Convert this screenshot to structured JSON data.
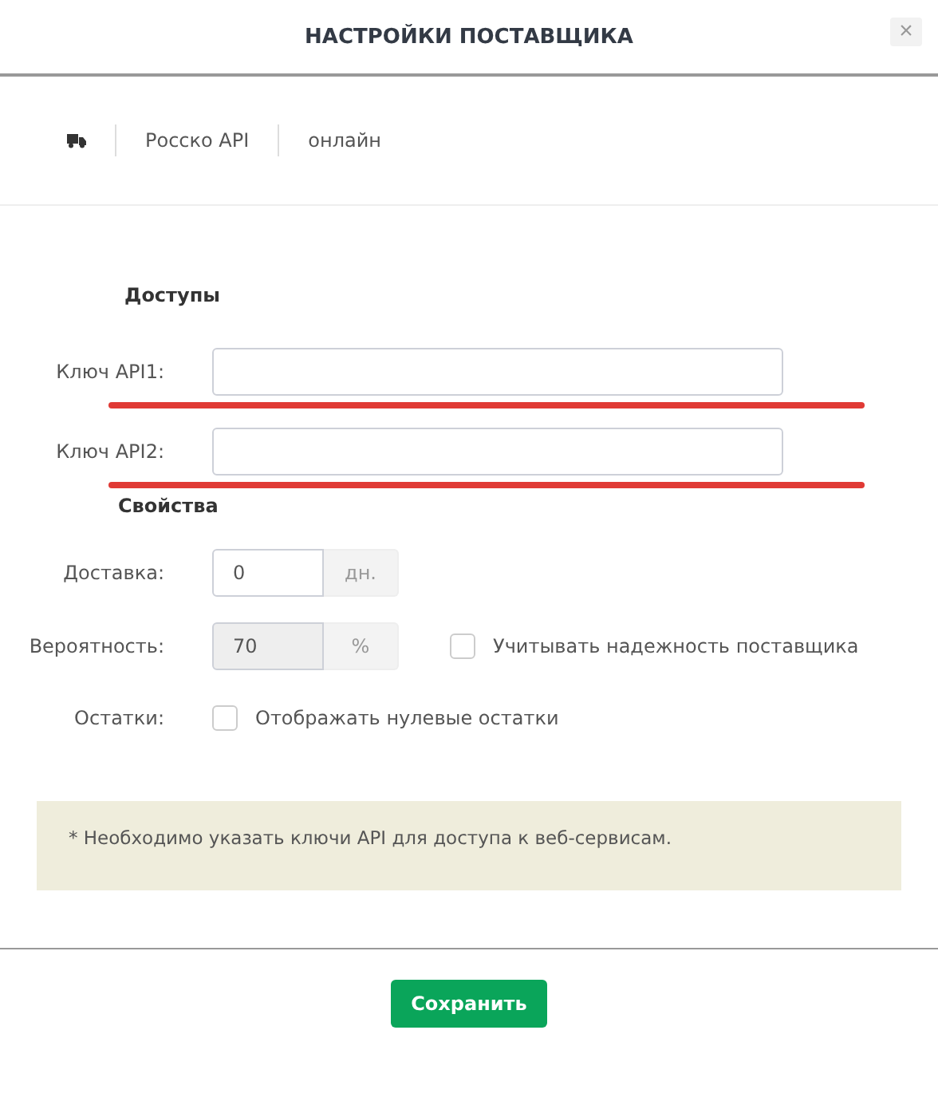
{
  "dialog": {
    "title": "НАСТРОЙКИ ПОСТАВЩИКА",
    "close": "×"
  },
  "supplier": {
    "name": "Росско API",
    "status": "онлайн"
  },
  "access": {
    "heading": "Доступы",
    "fields": [
      {
        "label": "Ключ API1:",
        "highlighted": true
      },
      {
        "label": "Ключ API2:",
        "highlighted": true
      }
    ]
  },
  "properties": {
    "heading": "Свойства",
    "rows": [
      {
        "kind": "addon",
        "label": "Доставка:",
        "value": "0",
        "addon": "дн.",
        "disabled": false
      },
      {
        "kind": "addon",
        "label": "Вероятность:",
        "value": "70",
        "addon": "%",
        "disabled": true,
        "checkbox": {
          "label": "Учитывать надежность поставщика",
          "checked": false
        }
      },
      {
        "kind": "checkbox",
        "label": "Остатки:",
        "checkbox": {
          "label": "Отображать нулевые остатки",
          "checked": false
        }
      }
    ]
  },
  "note": "* Необходимо указать ключи API для доступа к веб-сервисам.",
  "buttons": [
    "Сохранить"
  ]
}
